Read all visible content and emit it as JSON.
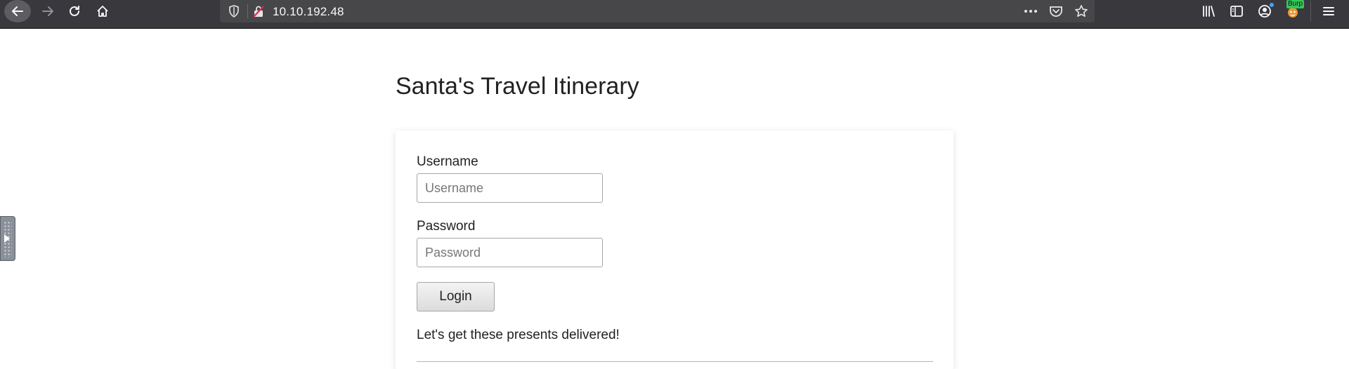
{
  "browser": {
    "url": "10.10.192.48",
    "extension_badge": "Burp"
  },
  "icons": {
    "back": "back-arrow-icon",
    "forward": "forward-arrow-icon",
    "reload": "reload-icon",
    "home": "home-icon",
    "tracking_protection": "shield-icon",
    "insecure": "insecure-lock-icon",
    "page_actions": "more-dots-icon",
    "pocket": "pocket-icon",
    "bookmark": "star-icon",
    "library": "library-icon",
    "sidebar": "sidebar-icon",
    "account": "account-icon",
    "burp": "burp-extension-icon",
    "menu": "hamburger-menu-icon"
  },
  "page": {
    "title": "Santa's Travel Itinerary",
    "username_label": "Username",
    "username_placeholder": "Username",
    "username_value": "",
    "password_label": "Password",
    "password_placeholder": "Password",
    "password_value": "",
    "login_label": "Login",
    "tagline": "Let's get these presents delivered!"
  },
  "colors": {
    "toolbar_bg": "#38383d",
    "urlbar_bg": "#474749",
    "text": "#222222"
  }
}
